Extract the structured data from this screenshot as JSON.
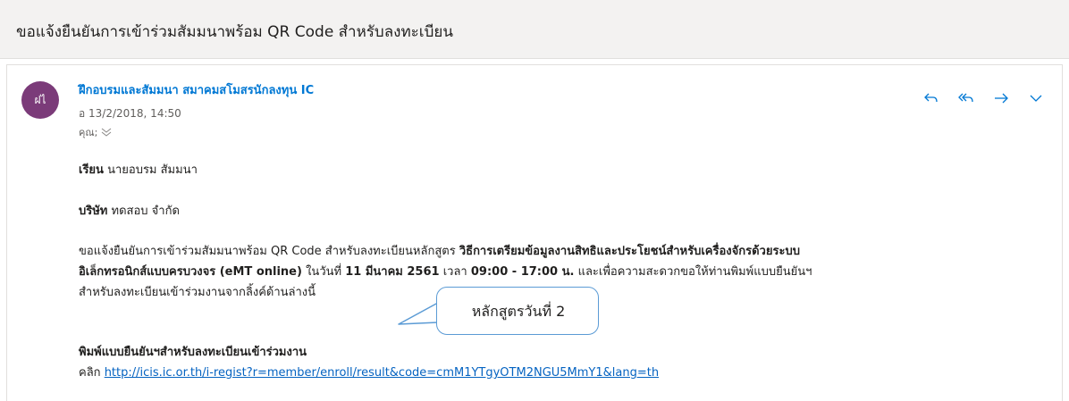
{
  "subject": "ขอแจ้งยืนยันการเข้าร่วมสัมมนาพร้อม QR Code สำหรับลงทะเบียน",
  "message": {
    "avatar_initials": "ฝไ",
    "avatar_color": "#7b3b79",
    "sender": "ฝึกอบรมและสัมมนา สมาคมสโมสรนักลงทุน IC",
    "date": "อ 13/2/2018, 14:50",
    "to": "คุณ;",
    "actions": [
      {
        "name": "reply",
        "icon": "reply-icon"
      },
      {
        "name": "reply-all",
        "icon": "reply-all-icon"
      },
      {
        "name": "forward",
        "icon": "forward-icon"
      },
      {
        "name": "more",
        "icon": "chevron-down-icon"
      }
    ]
  },
  "body": {
    "dear_label": "เรียน",
    "dear_name": "นายอบรม สัมมนา",
    "company_label": "บริษัท",
    "company_name": "ทดสอบ จำกัด",
    "p1_a": "ขอแจ้งยืนยันการเข้าร่วมสัมมนาพร้อม QR Code สำหรับลงทะเบียนหลักสูตร",
    "p1_b_bold": "วิธีการเตรียมข้อมูลงานสิทธิและประโยชน์สำหรับเครื่องจักรด้วยระบบ",
    "p2_bold": "อิเล็กทรอนิกส์แบบครบวงจร (eMT online)",
    "p2_c": "ในวันที่",
    "p2_d_bold": "11 มีนาคม 2561",
    "p2_e": "เวลา",
    "p2_f_bold": "09:00 - 17:00 น.",
    "p2_g": "และเพื่อความสะดวกขอให้ท่านพิมพ์แบบยืนยันฯ",
    "p3": "สำหรับลงทะเบียนเข้าร่วมงานจากลิ้งค์ด้านล่างนี้",
    "form_heading": "พิมพ์แบบยืนยันฯสำหรับลงทะเบียนเข้าร่วมงาน",
    "click_label": "คลิก",
    "link": "http://icis.ic.or.th/i-regist?r=member/enroll/result&code=cmM1YTgyOTM2NGU5MmY1&lang=th"
  },
  "callout": {
    "text": "หลักสูตรวันที่ 2",
    "border_color": "#5b9bd5"
  }
}
